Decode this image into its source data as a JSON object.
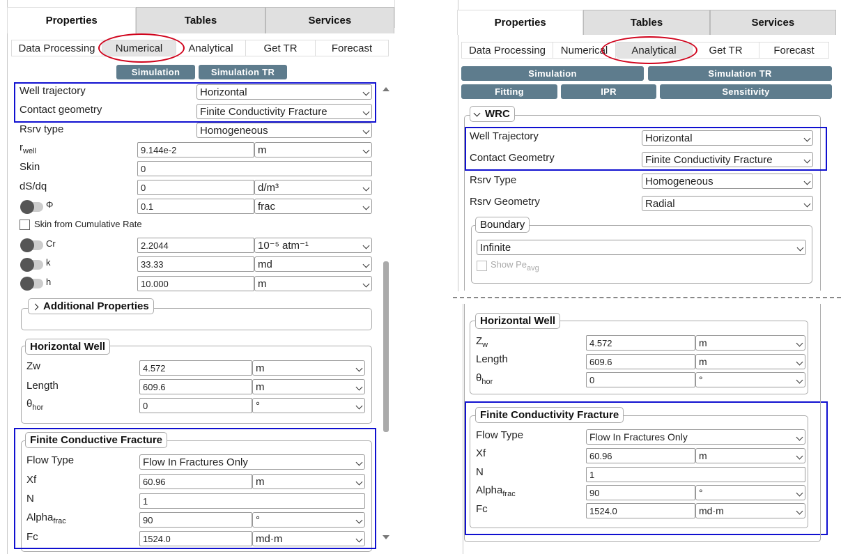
{
  "tabs": [
    "Properties",
    "Tables",
    "Services"
  ],
  "left": {
    "subtabs": [
      "Data Processing",
      "Numerical",
      "Analytical",
      "Get TR",
      "Forecast"
    ],
    "active_subtab": "Numerical",
    "buttons": [
      "Simulation",
      "Simulation TR"
    ],
    "rows": {
      "well_trajectory": {
        "label": "Well trajectory",
        "value": "Horizontal"
      },
      "contact_geometry": {
        "label": "Contact geometry",
        "value": "Finite Conductivity Fracture"
      },
      "rsrv_type": {
        "label": "Rsrv type",
        "value": "Homogeneous"
      },
      "rwell": {
        "label": "r",
        "sub": "well",
        "value": "9.144e-2",
        "unit": "m"
      },
      "skin": {
        "label": "Skin",
        "value": "0"
      },
      "dsdq": {
        "label": "dS/dq",
        "value": "0",
        "unit": "d/m³"
      },
      "phi": {
        "label": "Φ",
        "value": "0.1",
        "unit": "frac"
      },
      "skin_cum": {
        "label": "Skin from Cumulative Rate"
      },
      "cr": {
        "label": "Cr",
        "value": "2.2044",
        "unit": "10⁻⁵ atm⁻¹"
      },
      "k": {
        "label": "k",
        "value": "33.33",
        "unit": "md"
      },
      "h": {
        "label": "h",
        "value": "10.000",
        "unit": "m"
      }
    },
    "additional_properties": "Additional Properties",
    "horizontal_well": {
      "title": "Horizontal Well",
      "zw": {
        "label": "Zw",
        "value": "4.572",
        "unit": "m"
      },
      "length": {
        "label": "Length",
        "value": "609.6",
        "unit": "m"
      },
      "theta": {
        "label": "θ",
        "sub": "hor",
        "value": "0",
        "unit": "°"
      }
    },
    "fracture": {
      "title": "Finite Conductive Fracture",
      "flow_type": {
        "label": "Flow Type",
        "value": "Flow In Fractures Only"
      },
      "xf": {
        "label": "Xf",
        "value": "60.96",
        "unit": "m"
      },
      "n": {
        "label": "N",
        "value": "1"
      },
      "alpha": {
        "label": "Alpha",
        "sub": "frac",
        "value": "90",
        "unit": "°"
      },
      "fc": {
        "label": "Fc",
        "value": "1524.0",
        "unit": "md·m"
      }
    }
  },
  "right": {
    "subtabs": [
      "Data Processing",
      "Numerical",
      "Analytical",
      "Get TR",
      "Forecast"
    ],
    "active_subtab": "Analytical",
    "buttons": [
      "Simulation",
      "Simulation TR",
      "Fitting",
      "IPR",
      "Sensitivity"
    ],
    "wrc": "WRC",
    "rows": {
      "well_trajectory": {
        "label": "Well Trajectory",
        "value": "Horizontal"
      },
      "contact_geometry": {
        "label": "Contact Geometry",
        "value": "Finite Conductivity Fracture"
      },
      "rsrv_type": {
        "label": "Rsrv Type",
        "value": "Homogeneous"
      },
      "rsrv_geometry": {
        "label": "Rsrv Geometry",
        "value": "Radial"
      }
    },
    "boundary": {
      "title": "Boundary",
      "value": "Infinite",
      "show_pe": "Show Pe",
      "show_pe_sub": "avg"
    },
    "horizontal_well": {
      "title": "Horizontal Well",
      "zw": {
        "label": "Z",
        "sub": "w",
        "value": "4.572",
        "unit": "m"
      },
      "length": {
        "label": "Length",
        "value": "609.6",
        "unit": "m"
      },
      "theta": {
        "label": "θ",
        "sub": "hor",
        "value": "0",
        "unit": "°"
      }
    },
    "fracture": {
      "title": "Finite Conductivity Fracture",
      "flow_type": {
        "label": "Flow Type",
        "value": "Flow In Fractures Only"
      },
      "xf": {
        "label": "Xf",
        "value": "60.96",
        "unit": "m"
      },
      "n": {
        "label": "N",
        "value": "1"
      },
      "alpha": {
        "label": "Alpha",
        "sub": "frac",
        "value": "90",
        "unit": "°"
      },
      "fc": {
        "label": "Fc",
        "value": "1524.0",
        "unit": "md·m"
      }
    }
  },
  "colors": {
    "highlight_box": "#1010d0",
    "highlight_ring": "#d0021b",
    "button": "#5e7c8d"
  }
}
